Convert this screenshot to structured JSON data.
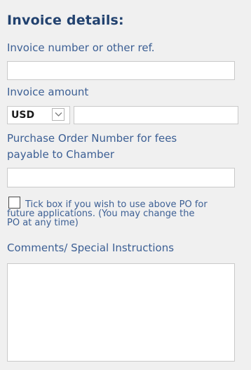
{
  "section": {
    "title": "Invoice details:"
  },
  "fields": {
    "invoice_ref": {
      "label": "Invoice number or other ref.",
      "value": ""
    },
    "invoice_amount": {
      "label": "Invoice amount",
      "currency_selected": "USD",
      "value": ""
    },
    "po_number": {
      "label_line1": "Purchase Order Number for fees",
      "label_line2": "payable to Chamber",
      "value": ""
    },
    "use_po": {
      "checked": false,
      "note_line1": "Tick box if you wish to use above PO for",
      "note_line2": "future applications. (You may change the",
      "note_line3": "PO at any time)"
    },
    "comments": {
      "label": "Comments/ Special Instructions",
      "value": ""
    }
  },
  "icons": {
    "currency_dropdown": "chevron-down-icon"
  },
  "colors": {
    "background": "#f0f0f0",
    "title": "#22426f",
    "label": "#3c5f94",
    "input_border": "#c9c9c9"
  }
}
